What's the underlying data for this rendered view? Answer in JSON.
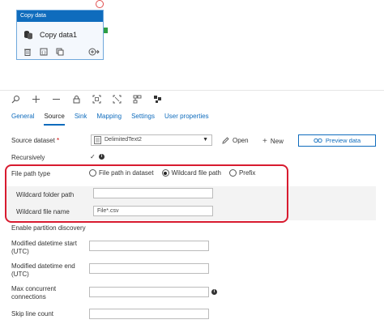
{
  "activity": {
    "header": "Copy data",
    "name": "Copy data1"
  },
  "toolbar": {
    "icons": [
      "search-icon",
      "plus-icon",
      "minus-icon",
      "lock-icon",
      "zoom-fit-icon",
      "select-icon",
      "arrange-icon",
      "layout-icon"
    ]
  },
  "tabs": [
    "General",
    "Source",
    "Sink",
    "Mapping",
    "Settings",
    "User properties"
  ],
  "active_tab": "Source",
  "source": {
    "dataset_label": "Source dataset",
    "dataset_value": "DelimitedText2",
    "open_label": "Open",
    "new_label": "New",
    "preview_label": "Preview data",
    "recursively_label": "Recursively",
    "file_path_type_label": "File path type",
    "file_path_options": [
      "File path in dataset",
      "Wildcard file path",
      "Prefix"
    ],
    "selected_option": "Wildcard file path",
    "wildcard_folder_label": "Wildcard folder path",
    "wildcard_folder_value": "",
    "wildcard_file_label": "Wildcard file name",
    "wildcard_file_value": "File*.csv",
    "partition_label": "Enable partition discovery",
    "mod_start_label": "Modified datetime start (UTC)",
    "mod_end_label": "Modified datetime end (UTC)",
    "max_conn_label": "Max concurrent connections",
    "skip_line_label": "Skip line count"
  },
  "colors": {
    "accent": "#0f6cbd",
    "highlight": "#d81b2f",
    "port": "#2e9e44"
  }
}
